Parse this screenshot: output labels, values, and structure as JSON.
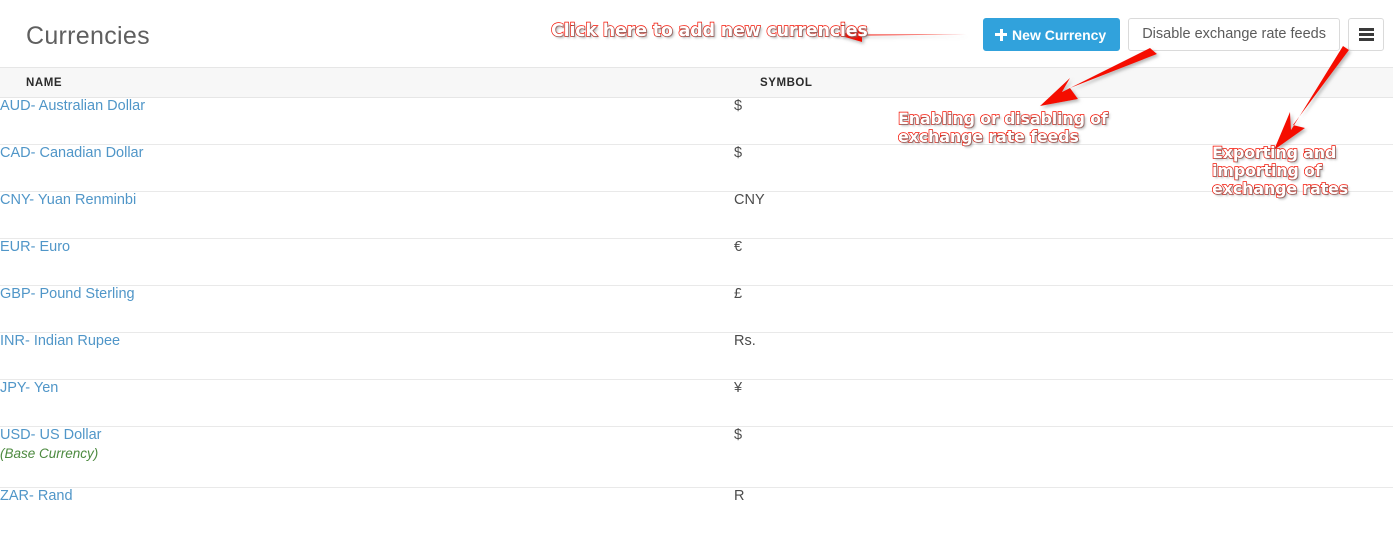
{
  "header": {
    "title": "Currencies",
    "new_currency_label": "New Currency",
    "new_currency_icon": "plus-icon",
    "disable_feeds_label": "Disable exchange rate feeds",
    "menu_icon": "hamburger-menu-icon",
    "accent_blue": "#31a2dc",
    "link_blue": "#5096c8",
    "annotation_red": "#f51000"
  },
  "table": {
    "columns": [
      "NAME",
      "SYMBOL"
    ],
    "rows": [
      {
        "name": "AUD- Australian Dollar",
        "symbol": "$",
        "note": ""
      },
      {
        "name": "CAD- Canadian Dollar",
        "symbol": "$",
        "note": ""
      },
      {
        "name": "CNY- Yuan Renminbi",
        "symbol": "CNY",
        "note": ""
      },
      {
        "name": "EUR- Euro",
        "symbol": "€",
        "note": ""
      },
      {
        "name": "GBP- Pound Sterling",
        "symbol": "£",
        "note": ""
      },
      {
        "name": "INR- Indian Rupee",
        "symbol": "Rs.",
        "note": ""
      },
      {
        "name": "JPY- Yen",
        "symbol": "¥",
        "note": ""
      },
      {
        "name": "USD- US Dollar",
        "symbol": "$",
        "note": "(Base Currency)"
      },
      {
        "name": "ZAR- Rand",
        "symbol": "R",
        "note": ""
      }
    ]
  },
  "annotations": [
    {
      "id": "new-currency",
      "text": "Click here to add new currencies"
    },
    {
      "id": "feeds",
      "text": "Enabling or disabling of\nexchange rate feeds"
    },
    {
      "id": "export",
      "text": "Exporting and\nimporting of\nexchange rates"
    }
  ]
}
